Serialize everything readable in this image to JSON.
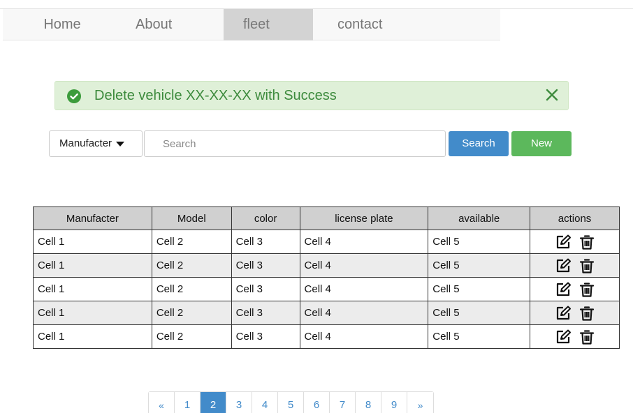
{
  "nav": {
    "items": [
      {
        "label": "Home",
        "active": false
      },
      {
        "label": "About",
        "active": false
      },
      {
        "label": "fleet",
        "active": true
      },
      {
        "label": "contact",
        "active": false
      }
    ]
  },
  "alert": {
    "message": "Delete vehicle XX-XX-XX with Success",
    "icon": "check-circle-icon",
    "close_icon": "close-icon",
    "color": "#3c8a3c",
    "background": "#dff0d8"
  },
  "search": {
    "filter_label": "Manufacter",
    "placeholder": "Search",
    "value": "",
    "search_button": "Search",
    "new_button": "New"
  },
  "table": {
    "columns": [
      "Manufacter",
      "Model",
      "color",
      "license plate",
      "available",
      "actions"
    ],
    "rows": [
      [
        "Cell 1",
        "Cell 2",
        "Cell 3",
        "Cell 4",
        "Cell 5"
      ],
      [
        "Cell 1",
        "Cell 2",
        "Cell 3",
        "Cell 4",
        "Cell 5"
      ],
      [
        "Cell 1",
        "Cell 2",
        "Cell 3",
        "Cell 4",
        "Cell 5"
      ],
      [
        "Cell 1",
        "Cell 2",
        "Cell 3",
        "Cell 4",
        "Cell 5"
      ],
      [
        "Cell 1",
        "Cell 2",
        "Cell 3",
        "Cell 4",
        "Cell 5"
      ]
    ],
    "row_actions": [
      "edit-icon",
      "trash-icon"
    ]
  },
  "pagination": {
    "prev": "«",
    "pages": [
      "1",
      "2",
      "3",
      "4",
      "5",
      "6",
      "7",
      "8",
      "9"
    ],
    "current": "2",
    "next": "»",
    "accent": "#428bca"
  }
}
